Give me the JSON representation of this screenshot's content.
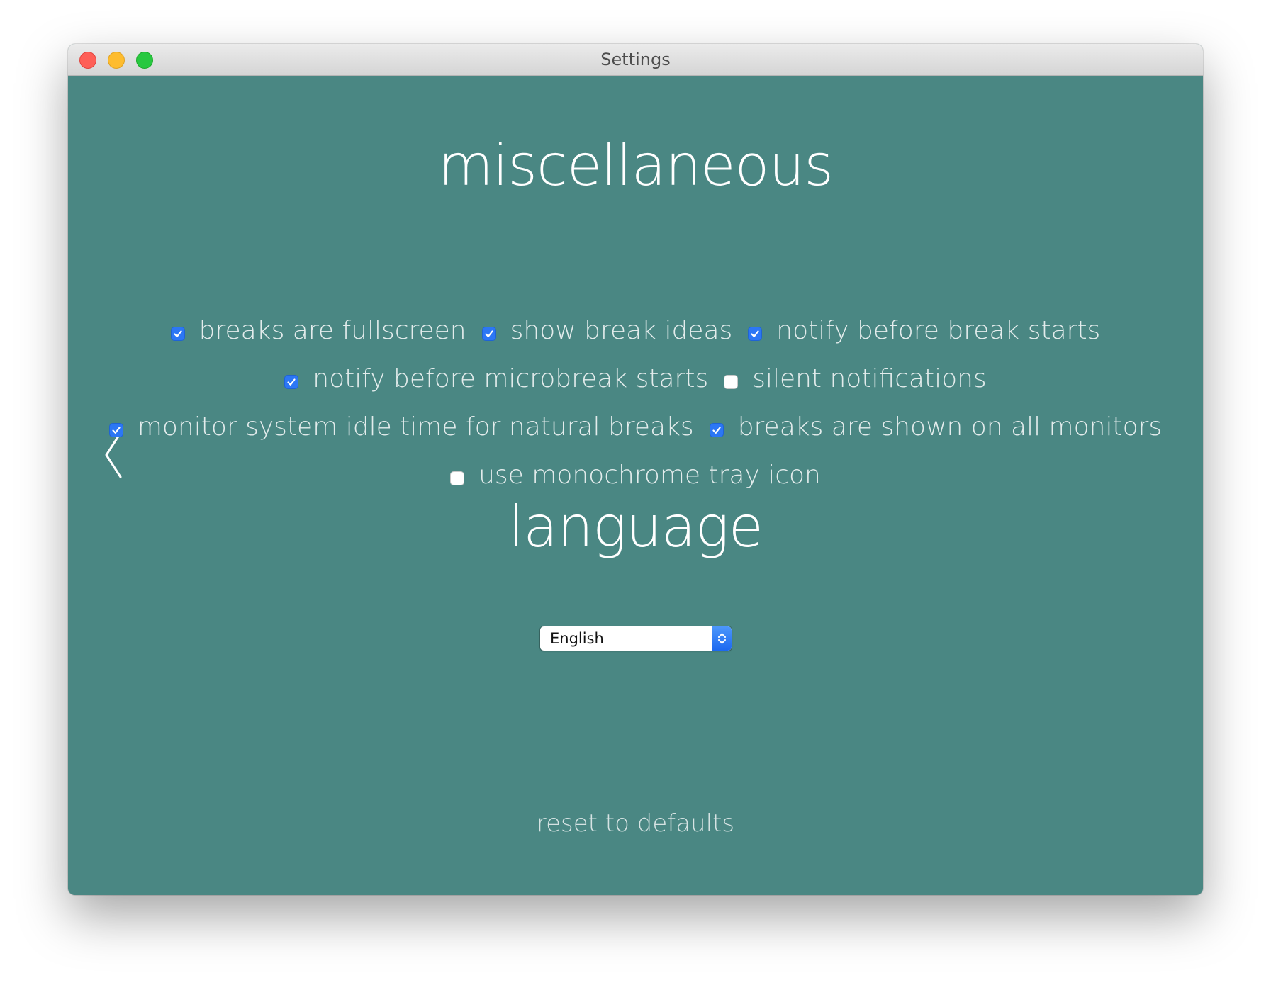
{
  "window": {
    "title": "Settings"
  },
  "misc": {
    "title": "miscellaneous",
    "rows": [
      [
        {
          "label": "breaks are fullscreen",
          "checked": true
        },
        {
          "label": "show break ideas",
          "checked": true
        },
        {
          "label": "notify before break starts",
          "checked": true
        }
      ],
      [
        {
          "label": "notify before microbreak starts",
          "checked": true
        },
        {
          "label": "silent notifications",
          "checked": false
        }
      ],
      [
        {
          "label": "monitor system idle time for natural breaks",
          "checked": true
        },
        {
          "label": "breaks are shown on all monitors",
          "checked": true
        }
      ],
      [
        {
          "label": "use monochrome tray icon",
          "checked": false
        }
      ]
    ]
  },
  "language": {
    "title": "language",
    "selected": "English"
  },
  "footer": {
    "reset_label": "reset to defaults"
  },
  "colors": {
    "background": "#4a8783",
    "checkbox_checked": "#2c77f5",
    "text": "#e3ecec"
  },
  "icons": {
    "back": "chevron-left-icon",
    "select": "up-down-chevron-icon",
    "check": "checkmark-icon"
  }
}
